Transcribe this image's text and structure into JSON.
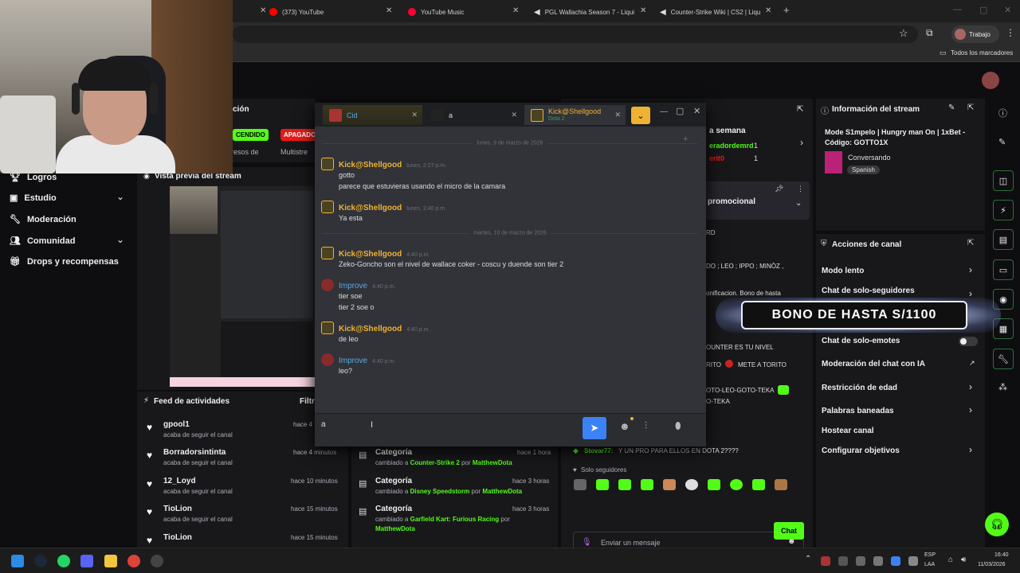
{
  "browser": {
    "tabs": [
      {
        "label": "(373) YouTube",
        "color": "#ff0000"
      },
      {
        "label": "YouTube Music",
        "color": "#ff0033"
      },
      {
        "label": "PGL Wallachia Season 7 - Liqui",
        "color": "#cccccc"
      },
      {
        "label": "Counter-Strike Wiki | CS2 | Liqu",
        "color": "#cccccc"
      }
    ],
    "profile_label": "Trabajo",
    "bookmarks_label": "Todos los marcadores"
  },
  "nav": {
    "items": [
      {
        "label": "Logros",
        "icon": "trophy-icon"
      },
      {
        "label": "Estudio",
        "icon": "camera-icon"
      },
      {
        "label": "Moderación",
        "icon": "wrench-icon"
      },
      {
        "label": "Comunidad",
        "icon": "people-icon"
      },
      {
        "label": "Drops y recompensas",
        "icon": "gift-icon"
      }
    ]
  },
  "fragments": {
    "section_title_tail": "ción",
    "btn_encendido": "CENDIDO",
    "btn_apagado": "APAGADO",
    "ingresos_tail": "resos de",
    "multistream_tail": "Multistre",
    "preview_title": "Vista previa del stream",
    "semana_title": "a semana",
    "user1": "eradordemrd",
    "user1_count": "1",
    "user2": "erit0",
    "user2_count": "1",
    "promo_title": "promocional",
    "chat_line_rd": "RD",
    "chat_line_do": "DO ; LEO ; IPPO ; MINÒZ ,",
    "chat_line_bon": "onificacion. Bono de hasta",
    "chat_line_ounter": "OUNTER ES TU NIVEL",
    "chat_line_rito": "RITO",
    "chat_line_mete": "METE A TORITO",
    "chat_line_goto": "OTO-LEO-GOTO-TEKA",
    "chat_line_teka": "O-TEKA"
  },
  "feed": {
    "title": "Feed de actividades",
    "filter": "Filtr",
    "items": [
      {
        "name": "gpool1",
        "action": "acaba de seguir el canal",
        "time": "hace 4"
      },
      {
        "name": "Borradorsintinta",
        "action": "acaba de seguir el canal",
        "time": "hace 4 minutos"
      },
      {
        "name": "12_Loyd",
        "action": "acaba de seguir el canal",
        "time": "hace 10 minutos"
      },
      {
        "name": "TioLion",
        "action": "acaba de seguir el canal",
        "time": "hace 15 minutos"
      },
      {
        "name": "TioLion",
        "action": "",
        "time": "hace 15 minutos"
      }
    ]
  },
  "category_feed": {
    "items": [
      {
        "title": "Categoría",
        "prefix": "cambiado a",
        "game": "Counter-Strike 2",
        "by": "por",
        "user": "MatthewDota",
        "time": "hace 1 hora"
      },
      {
        "title": "Categoría",
        "prefix": "cambiado a",
        "game": "Disney Speedstorm",
        "by": "por",
        "user": "MatthewDota",
        "time": "hace 3 horas"
      },
      {
        "title": "Categoría",
        "prefix": "cambiado a",
        "game": "Garfield Kart: Furious Racing",
        "by": "por",
        "user": "MatthewDota",
        "time": "hace 3 horas"
      }
    ]
  },
  "stream_chat": {
    "last_message_user": "Stovar77:",
    "last_message_text": "Y UN PRO PARA ELLOS EN DOTA 2????",
    "mode": "Solo seguidores",
    "input_placeholder": "Enviar un mensaje",
    "points": "0",
    "send_label": "Chat"
  },
  "stream_info": {
    "title": "Información del stream",
    "stream_title": "Mode S1mpelo | Hungry man On | 1xBet - Código: GOTTO1X",
    "category": "Conversando",
    "language": "Spanish"
  },
  "channel_actions": {
    "title": "Acciones de canal",
    "items": [
      {
        "label": "Modo lento",
        "chevron": true
      },
      {
        "label": "Chat de solo-seguidores",
        "chevron": true
      },
      {
        "label": "Chat de solo-emotes",
        "chevron": false
      },
      {
        "label": "Moderación del chat con IA",
        "chevron": false
      },
      {
        "label": "Restricción de edad",
        "chevron": true
      },
      {
        "label": "Palabras baneadas",
        "chevron": true
      },
      {
        "label": "Hostear canal",
        "chevron": false
      },
      {
        "label": "Configurar objetivos",
        "chevron": true
      }
    ]
  },
  "promo_banner": {
    "text": "BONO DE HASTA S/1100"
  },
  "discord": {
    "tabs": [
      {
        "label": "Cid",
        "sub": ""
      },
      {
        "label": "a",
        "sub": ""
      },
      {
        "label": "Kick@Shellgood",
        "sub": "Dota 2"
      }
    ],
    "date1": "lunes, 9 de marzo de 2026",
    "date2": "martes, 10 de marzo de 2026",
    "messages": [
      {
        "author": "Kick@Shellgood",
        "time": "lunes, 2:27 p.m.",
        "lines": [
          "gotto",
          "parece que estuvieras usando el micro de la camara"
        ]
      },
      {
        "author": "Kick@Shellgood",
        "time": "lunes, 2:40 p.m.",
        "lines": [
          "Ya esta"
        ]
      },
      {
        "author": "Kick@Shellgood",
        "time": "4:40 p.m.",
        "lines": [
          "Zeko-Goncho son el nivel de wallace coker - coscu y duende son tier 2"
        ]
      },
      {
        "author": "Improve",
        "time": "4:40 p.m.",
        "lines": [
          "tier soe",
          "tier 2 soe o"
        ]
      },
      {
        "author": "Kick@Shellgood",
        "time": "4:40 p.m.",
        "lines": [
          "de leo"
        ]
      },
      {
        "author": "Improve",
        "time": "4:40 p.m.",
        "lines": [
          "leo?"
        ]
      }
    ],
    "input_value": "a"
  },
  "taskbar": {
    "lang": "ESP",
    "lang2": "LAA",
    "time": "16:40",
    "date": "11/03/2026"
  },
  "colors": {
    "accent_green": "#53fc18",
    "kick_name": "#f0b232",
    "improve_name": "#5aa9e6",
    "discord_send": "#5865f2"
  }
}
